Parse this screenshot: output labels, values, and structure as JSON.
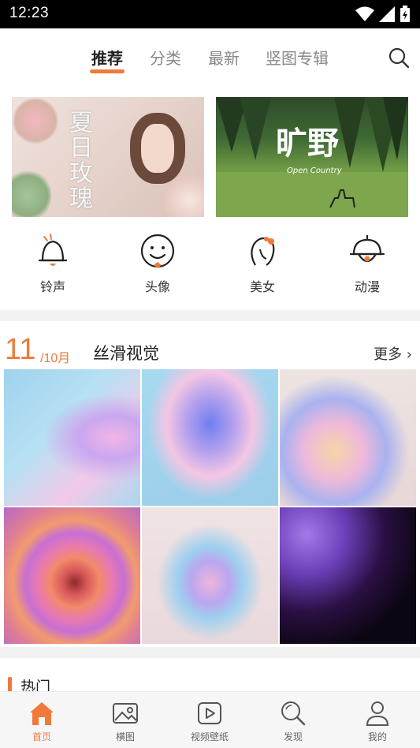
{
  "status_bar": {
    "time": "12:23"
  },
  "top_tabs": [
    {
      "label": "推荐",
      "active": true
    },
    {
      "label": "分类",
      "active": false
    },
    {
      "label": "最新",
      "active": false
    },
    {
      "label": "竖图专辑",
      "active": false
    }
  ],
  "banners": [
    {
      "title": "夏日玫瑰"
    },
    {
      "title": "旷野",
      "subtitle": "Open Country"
    }
  ],
  "categories": [
    {
      "label": "铃声",
      "icon": "bell-icon"
    },
    {
      "label": "头像",
      "icon": "smiley-face-icon"
    },
    {
      "label": "美女",
      "icon": "girl-profile-icon"
    },
    {
      "label": "动漫",
      "icon": "anime-bell-icon"
    }
  ],
  "section": {
    "day": "11",
    "month": "/10月",
    "title": "丝滑视觉",
    "more": "更多"
  },
  "hot": {
    "label": "热门"
  },
  "bottom_nav": [
    {
      "label": "首页",
      "icon": "home-icon",
      "active": true
    },
    {
      "label": "横图",
      "icon": "image-icon",
      "active": false
    },
    {
      "label": "视频壁纸",
      "icon": "video-icon",
      "active": false
    },
    {
      "label": "发现",
      "icon": "search-icon",
      "active": false
    },
    {
      "label": "我的",
      "icon": "person-icon",
      "active": false
    }
  ],
  "colors": {
    "accent": "#f07a3a"
  }
}
